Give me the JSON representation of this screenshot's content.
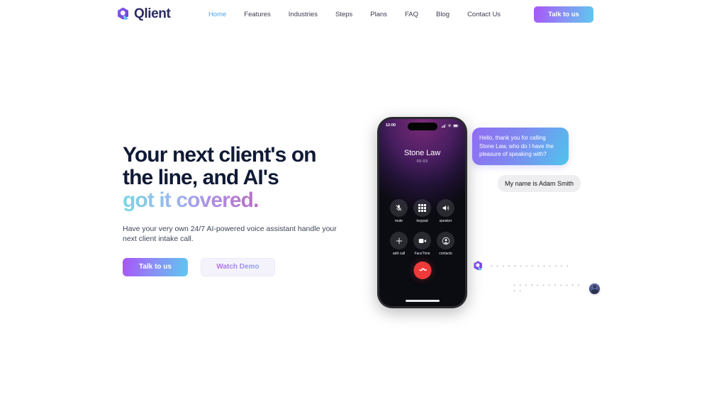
{
  "brand": {
    "name": "Qlient",
    "logo_icon": "qlient-cube-logo"
  },
  "nav": {
    "items": [
      {
        "label": "Home",
        "active": true
      },
      {
        "label": "Features",
        "active": false
      },
      {
        "label": "Industries",
        "active": false
      },
      {
        "label": "Steps",
        "active": false
      },
      {
        "label": "Plans",
        "active": false
      },
      {
        "label": "FAQ",
        "active": false
      },
      {
        "label": "Blog",
        "active": false
      },
      {
        "label": "Contact Us",
        "active": false
      }
    ],
    "cta_label": "Talk to us"
  },
  "hero": {
    "headline_line1": "Your next client's on",
    "headline_line2": "the line, and AI's",
    "headline_line3": "got it covered.",
    "subtitle": "Have your very own 24/7 AI-powered voice assistant handle your next client intake call.",
    "primary_button": "Talk to us",
    "secondary_button": "Watch Demo"
  },
  "phone": {
    "status_time": "12:00",
    "status_icons": [
      "signal-icon",
      "wifi-icon",
      "battery-icon"
    ],
    "callee_name": "Stone Law",
    "call_timer": "00:03",
    "keys": [
      {
        "label": "mute",
        "icon": "microphone-muted-icon"
      },
      {
        "label": "keypad",
        "icon": "keypad-grid-icon"
      },
      {
        "label": "speaker",
        "icon": "speaker-icon"
      },
      {
        "label": "add call",
        "icon": "plus-icon"
      },
      {
        "label": "FaceTime",
        "icon": "video-camera-icon"
      },
      {
        "label": "contacts",
        "icon": "contacts-person-icon"
      }
    ],
    "end_call_icon": "end-call-handset-icon"
  },
  "chat": {
    "ai_message": "Hello, thank you for calling Stone Law, who do I have the pleasure of speaking with?",
    "user_message": "My name is Adam Smith",
    "typing_dots": "• • • • • • • • • • • • • •"
  },
  "colors": {
    "accent_purple": "#a855f7",
    "accent_cyan": "#5ec8ee",
    "nav_active": "#4aa3e8",
    "headline": "#101a36",
    "end_call_red": "#f03a3a"
  }
}
